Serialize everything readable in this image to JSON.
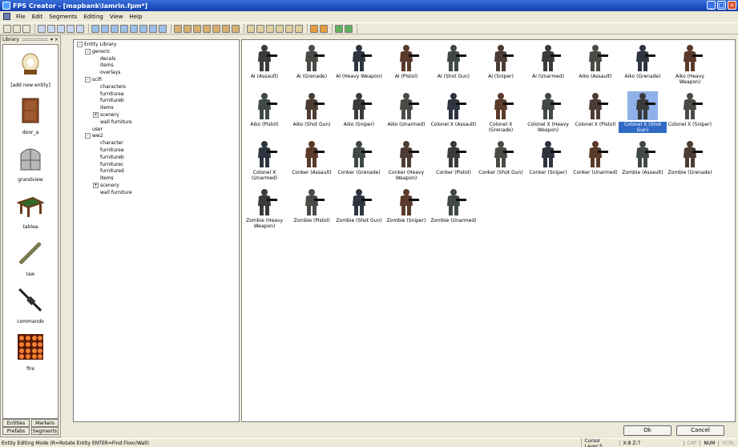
{
  "window": {
    "title": "FPS Creator - [mapbank\\lamrin.fpm*]"
  },
  "menu": [
    "File",
    "Edit",
    "Segments",
    "Editing",
    "View",
    "Help"
  ],
  "library": {
    "title": "Library",
    "items": [
      {
        "label": "[add new entity]",
        "icon": "lamp-icon"
      },
      {
        "label": "door_a",
        "icon": "door-icon"
      },
      {
        "label": "grandview",
        "icon": "window-icon"
      },
      {
        "label": "tablea",
        "icon": "table-icon"
      },
      {
        "label": "law",
        "icon": "launcher-icon"
      },
      {
        "label": "commando",
        "icon": "rifle-icon"
      },
      {
        "label": "fire",
        "icon": "fire-icon"
      }
    ],
    "tabs": [
      "Entities",
      "Markers",
      "Prefabs",
      "Segments"
    ]
  },
  "tree": [
    {
      "label": "Entity Library",
      "level": 0,
      "exp": "-"
    },
    {
      "label": "generic",
      "level": 1,
      "exp": "-"
    },
    {
      "label": "decals",
      "level": 2,
      "exp": ""
    },
    {
      "label": "items",
      "level": 2,
      "exp": ""
    },
    {
      "label": "overlays",
      "level": 2,
      "exp": ""
    },
    {
      "label": "scifi",
      "level": 1,
      "exp": "-"
    },
    {
      "label": "characters",
      "level": 2,
      "exp": ""
    },
    {
      "label": "furniturea",
      "level": 2,
      "exp": ""
    },
    {
      "label": "furnitureb",
      "level": 2,
      "exp": ""
    },
    {
      "label": "items",
      "level": 2,
      "exp": ""
    },
    {
      "label": "scenery",
      "level": 2,
      "exp": "+"
    },
    {
      "label": "wall furniture",
      "level": 2,
      "exp": ""
    },
    {
      "label": "user",
      "level": 1,
      "exp": ""
    },
    {
      "label": "ww2",
      "level": 1,
      "exp": "-"
    },
    {
      "label": "character",
      "level": 2,
      "exp": ""
    },
    {
      "label": "furniturea",
      "level": 2,
      "exp": ""
    },
    {
      "label": "furnitureb",
      "level": 2,
      "exp": ""
    },
    {
      "label": "furniturec",
      "level": 2,
      "exp": ""
    },
    {
      "label": "furnitured",
      "level": 2,
      "exp": ""
    },
    {
      "label": "items",
      "level": 2,
      "exp": ""
    },
    {
      "label": "scenery",
      "level": 2,
      "exp": "+"
    },
    {
      "label": "wall furniture",
      "level": 2,
      "exp": ""
    }
  ],
  "entities": [
    "AI (Assault)",
    "AI (Grenade)",
    "AI (Heavy Weapon)",
    "AI (Pistol)",
    "AI (Shot Gun)",
    "AI (Sniper)",
    "AI (Unarmed)",
    "Aiko (Assault)",
    "Aiko (Grenade)",
    "Aiko (Heavy Weapon)",
    "Aiko (Pistol)",
    "Aiko (Shot Gun)",
    "Aiko (Sniper)",
    "Aiko (Unarmed)",
    "Colonel X (Assault)",
    "Colonel X (Grenade)",
    "Colonel X (Heavy Weapon)",
    "Colonel X (Pistol)",
    "Colonel X (Shot Gun)",
    "Colonel X (Sniper)",
    "Colonel X (Unarmed)",
    "Conker (Assault)",
    "Conker (Grenade)",
    "Conker (Heavy Weapon)",
    "Conker (Pistol)",
    "Conker (Shot Gun)",
    "Conker (Sniper)",
    "Conker (Unarmed)",
    "Zombie (Assault)",
    "Zombie (Grenade)",
    "Zombie (Heavy Weapon)",
    "Zombie (Pistol)",
    "Zombie (Shot Gun)",
    "Zombie (Sniper)",
    "Zombie (Unarmed)"
  ],
  "selected_entity": "Colonel X (Shot Gun)",
  "buttons": {
    "ok": "Ok",
    "cancel": "Cancel"
  },
  "status": {
    "left": "Entity Editing Mode (R=Rotate Entity  ENTER=Find Floor/Wall)",
    "cursor": "Cursor Layer:5",
    "coords": "X:8  Z:7",
    "caps": "CAP",
    "num": "NUM",
    "scrl": "SCRL"
  }
}
